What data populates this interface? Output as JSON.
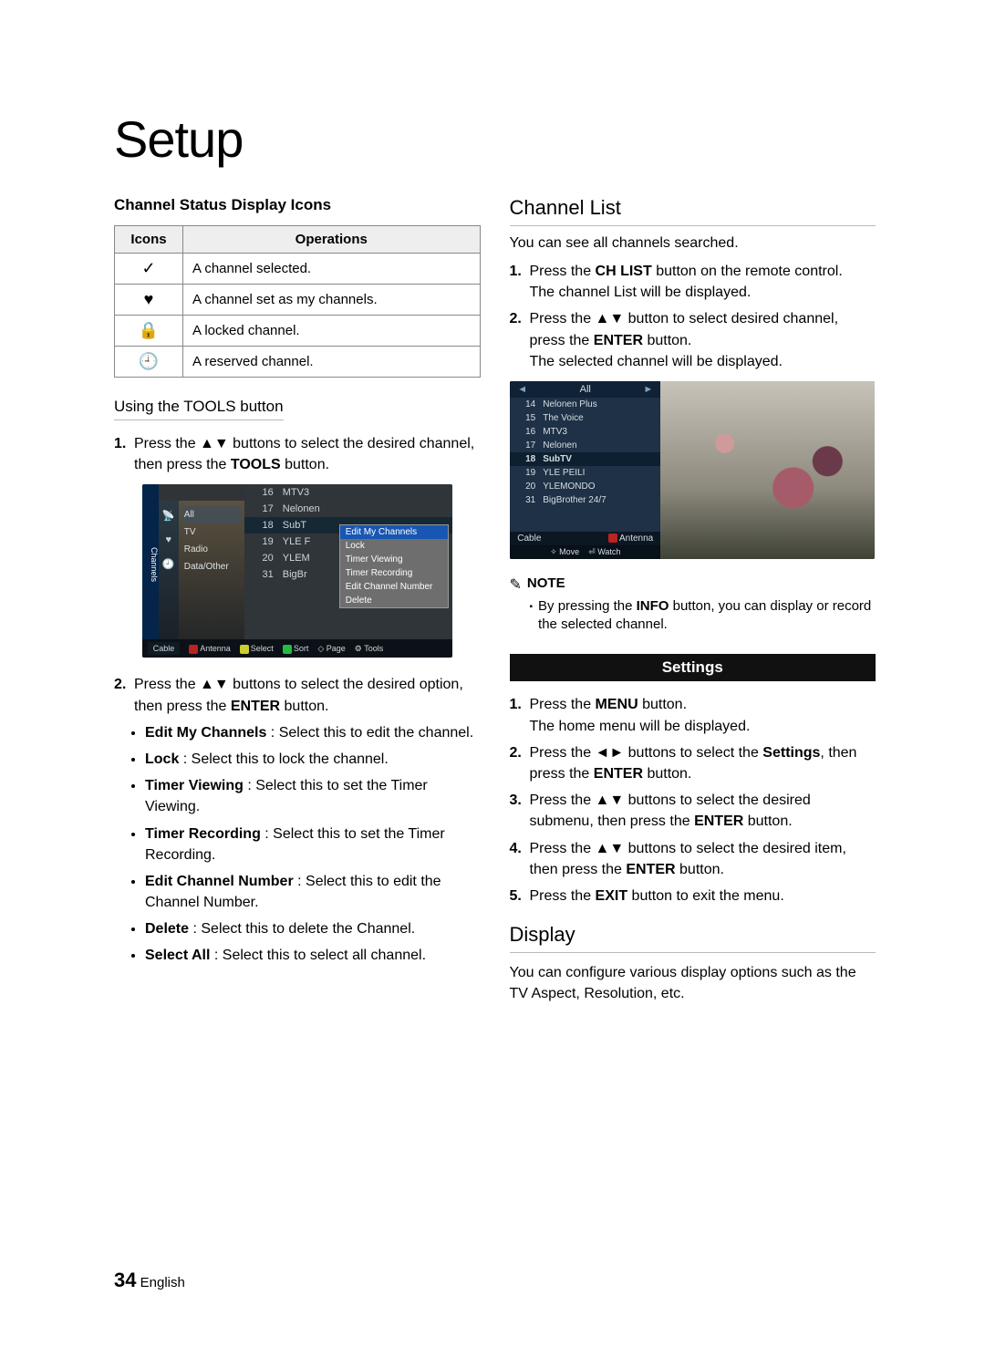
{
  "page": {
    "title": "Setup",
    "number": "34",
    "lang": "English"
  },
  "left": {
    "icons_heading": "Channel Status Display Icons",
    "table": {
      "headers": [
        "Icons",
        "Operations"
      ],
      "rows": [
        {
          "icon": "✓",
          "op": "A channel selected."
        },
        {
          "icon": "♥",
          "op": "A channel set as my channels."
        },
        {
          "icon": "🔒",
          "op": "A locked channel."
        },
        {
          "icon": "🕘",
          "op": "A reserved channel."
        }
      ]
    },
    "tools_heading": "Using the TOOLS button",
    "step1_pre": "Press the ",
    "arrows_ud": "▲▼",
    "step1_mid": " buttons to select the desired channel, then press the ",
    "tools_word": "TOOLS",
    "step1_post": " button.",
    "shot1": {
      "side_label": "Channels",
      "categories": [
        "All",
        "TV",
        "Radio",
        "Data/Other"
      ],
      "rows": [
        {
          "n": "16",
          "name": "MTV3"
        },
        {
          "n": "17",
          "name": "Nelonen"
        },
        {
          "n": "18",
          "name": "SubT",
          "hi": true
        },
        {
          "n": "19",
          "name": "YLE F"
        },
        {
          "n": "20",
          "name": "YLEM"
        },
        {
          "n": "31",
          "name": "BigBr"
        }
      ],
      "menu": [
        "Edit My Channels",
        "Lock",
        "Timer Viewing",
        "Timer Recording",
        "Edit Channel Number",
        "Delete"
      ],
      "footer": {
        "cable": "Cable",
        "a": "Antenna",
        "c": "Select",
        "b": "Sort",
        "page": "Page",
        "tools": "Tools"
      }
    },
    "step2_pre": "Press the ",
    "step2_mid": " buttons to select the desired option, then press the ",
    "enter_word": "ENTER",
    "step2_post": " button.",
    "bullets": [
      {
        "b": "Edit My Channels",
        "t": " : Select this to edit the channel."
      },
      {
        "b": "Lock",
        "t": " : Select this to lock the channel."
      },
      {
        "b": "Timer Viewing",
        "t": " : Select this to set the Timer Viewing."
      },
      {
        "b": "Timer Recording",
        "t": " : Select this to set the Timer Recording."
      },
      {
        "b": "Edit Channel Number",
        "t": " : Select this to edit the Channel Number."
      },
      {
        "b": "Delete",
        "t": " : Select this to delete the Channel."
      },
      {
        "b": "Select All",
        "t": " : Select this to select all channel."
      }
    ]
  },
  "right": {
    "heading": "Channel List",
    "intro": "You can see all channels searched.",
    "s1_pre": "Press the ",
    "chlist": "CH LIST",
    "s1_mid": " button on the remote control.",
    "s1_line2": "The channel List will be displayed.",
    "s2_pre": "Press the ",
    "s2_mid": " button to select desired channel, press the ",
    "s2_post": " button.",
    "s2_line2": "The selected channel will be displayed.",
    "shot2": {
      "tab": "All",
      "rows": [
        {
          "n": "14",
          "name": "Nelonen Plus"
        },
        {
          "n": "15",
          "name": "The Voice"
        },
        {
          "n": "16",
          "name": "MTV3"
        },
        {
          "n": "17",
          "name": "Nelonen"
        },
        {
          "n": "18",
          "name": "SubTV",
          "hi": true
        },
        {
          "n": "19",
          "name": "YLE PEILI"
        },
        {
          "n": "20",
          "name": "YLEMONDO"
        },
        {
          "n": "31",
          "name": "BigBrother 24/7"
        }
      ],
      "cable": "Cable",
      "antenna": "Antenna",
      "move": "Move",
      "watch": "Watch"
    },
    "note_label": "NOTE",
    "note_pre": "By pressing the ",
    "info_word": "INFO",
    "note_post": " button, you can display or record the selected channel.",
    "settings_bar": "Settings",
    "settings_steps": {
      "s1_pre": "Press the ",
      "menu_word": "MENU",
      "s1_post": " button.",
      "s1_line2": "The home menu will be displayed.",
      "s2_pre": "Press the ",
      "arrows_lr": "◄►",
      "s2_mid": " buttons to select the ",
      "settings_word": "Settings",
      "s2_mid2": ", then press the ",
      "s2_post": " button.",
      "s3_pre": "Press the ",
      "s3_mid": " buttons to select the desired submenu, then press the ",
      "s3_post": " button.",
      "s4_pre": "Press the ",
      "s4_mid": " buttons to select the desired item, then press the ",
      "s4_post": " button.",
      "s5_pre": "Press the ",
      "exit_word": "EXIT",
      "s5_post": " button to exit the menu."
    },
    "display_heading": "Display",
    "display_body": "You can configure various display options such as the TV Aspect, Resolution, etc."
  }
}
